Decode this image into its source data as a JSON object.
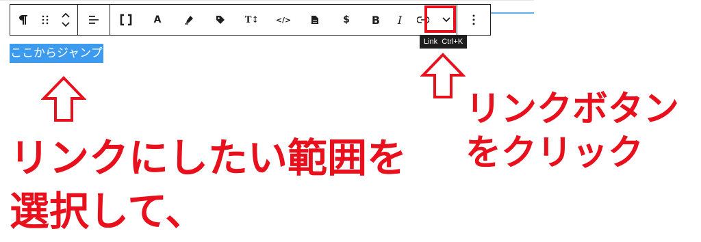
{
  "toolbar": {
    "paragraph_icon": "pilcrow-icon",
    "buttons": [
      {
        "name": "paragraph",
        "icon": "pilcrow-icon"
      },
      {
        "name": "drag",
        "icon": "drag-handle-icon"
      },
      {
        "name": "move",
        "icon": "chevron-up-down-icon"
      },
      {
        "name": "align",
        "icon": "align-left-icon"
      },
      {
        "name": "shortcode",
        "icon": "brackets-icon"
      },
      {
        "name": "font",
        "icon": "font-a-icon"
      },
      {
        "name": "highlight",
        "icon": "marker-icon"
      },
      {
        "name": "tag",
        "icon": "tag-icon"
      },
      {
        "name": "font-size",
        "icon": "font-size-icon"
      },
      {
        "name": "code",
        "icon": "code-icon"
      },
      {
        "name": "document",
        "icon": "document-icon"
      },
      {
        "name": "dollar",
        "icon": "dollar-icon"
      },
      {
        "name": "bold",
        "icon": "bold-icon"
      },
      {
        "name": "italic",
        "icon": "italic-icon"
      },
      {
        "name": "link",
        "icon": "link-icon"
      },
      {
        "name": "more-rich-text",
        "icon": "chevron-down-icon"
      },
      {
        "name": "options",
        "icon": "vertical-ellipsis-icon"
      }
    ],
    "align_label": "",
    "font_label": "A",
    "font_size_label": "T↕",
    "code_label": "</>",
    "dollar_label": "$",
    "bold_label": "B",
    "italic_label": "I"
  },
  "tooltip": {
    "text": "Link  Ctrl+K"
  },
  "editor": {
    "selected_text": "ここからジャンプ"
  },
  "annotations": {
    "right_line1": "リンクボタン",
    "right_line2": "をクリック",
    "left_line1": "リンクにしたい範囲を",
    "left_line2": "選択して、",
    "color": "#e8101c"
  },
  "colors": {
    "selection": "#3d9bef",
    "highlight_box": "#e8101c",
    "accent_rule": "#5ab0f0"
  }
}
